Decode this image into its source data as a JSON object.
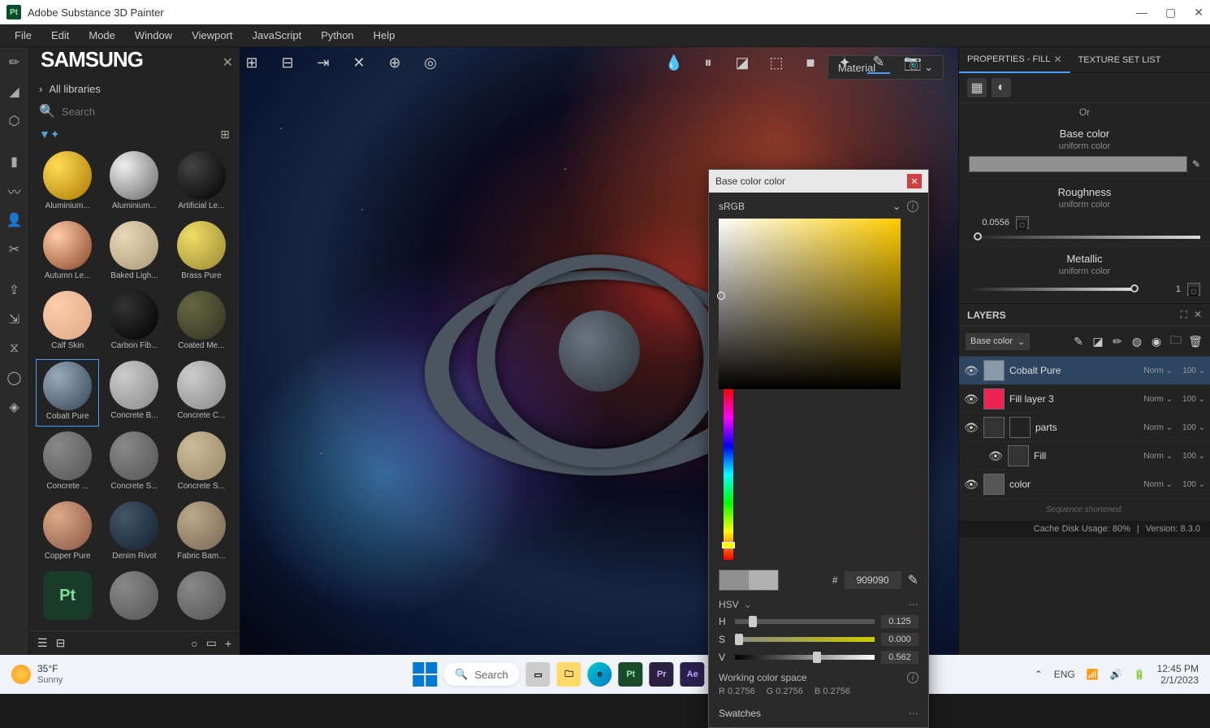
{
  "app_title": "Adobe Substance 3D Painter",
  "samsung_overlay": "SAMSUNG",
  "menus": [
    "File",
    "Edit",
    "Mode",
    "Window",
    "Viewport",
    "JavaScript",
    "Python",
    "Help"
  ],
  "asset_panel": {
    "nav": "All libraries",
    "search_placeholder": "Search",
    "items": [
      {
        "label": "Aluminium...",
        "cls": "t-gold"
      },
      {
        "label": "Aluminium...",
        "cls": "t-silver"
      },
      {
        "label": "Artificial Le...",
        "cls": "t-black"
      },
      {
        "label": "Autumn Le...",
        "cls": "t-leaf"
      },
      {
        "label": "Baked Ligh...",
        "cls": "t-tan"
      },
      {
        "label": "Brass Pure",
        "cls": "t-brass"
      },
      {
        "label": "Calf Skin",
        "cls": "t-skin"
      },
      {
        "label": "Carbon Fib...",
        "cls": "t-carbon"
      },
      {
        "label": "Coated Me...",
        "cls": "t-coat"
      },
      {
        "label": "Cobalt Pure",
        "cls": "t-cobalt",
        "selected": true
      },
      {
        "label": "Concrete B...",
        "cls": "t-conc"
      },
      {
        "label": "Concrete C...",
        "cls": "t-conc"
      },
      {
        "label": "Concrete ...",
        "cls": "t-concd"
      },
      {
        "label": "Concrete S...",
        "cls": "t-concd"
      },
      {
        "label": "Concrete S...",
        "cls": "t-tan2"
      },
      {
        "label": "Copper Pure",
        "cls": "t-copper"
      },
      {
        "label": "Denim Rivot",
        "cls": "t-denim"
      },
      {
        "label": "Fabric Bam...",
        "cls": "t-fabric"
      }
    ]
  },
  "viewport": {
    "material_dropdown": "Material"
  },
  "color_picker": {
    "title": "Base color color",
    "space": "sRGB",
    "hex_prefix": "#",
    "hex": "909090",
    "hsv_label": "HSV",
    "h": "0.125",
    "s": "0.000",
    "v": "0.562",
    "wcs": "Working color space",
    "r": "R 0.2756",
    "g": "G 0.2756",
    "b": "B 0.2756",
    "swatches": "Swatches"
  },
  "right_panel": {
    "tabs": {
      "properties": "PROPERTIES - FILL",
      "textureset": "TEXTURE SET LIST"
    },
    "or": "Or",
    "base_color": {
      "title": "Base color",
      "sub": "uniform color"
    },
    "roughness": {
      "title": "Roughness",
      "sub": "uniform color",
      "value": "0.0556"
    },
    "metallic": {
      "title": "Metallic",
      "sub": "uniform color",
      "value": "1"
    }
  },
  "layers": {
    "title": "LAYERS",
    "channel": "Base color",
    "items": [
      {
        "name": "Cobalt Pure",
        "blend": "Norm",
        "opacity": "100",
        "active": true,
        "thumb": "#8899aa"
      },
      {
        "name": "Fill layer 3",
        "blend": "Norm",
        "opacity": "100",
        "thumb": "#ee2255"
      },
      {
        "name": "parts",
        "blend": "Norm",
        "opacity": "100",
        "thumb": "#333",
        "folder": true
      },
      {
        "name": "Fill",
        "blend": "Norm",
        "opacity": "100",
        "sub": true,
        "thumb": "#333"
      },
      {
        "name": "color",
        "blend": "Norm",
        "opacity": "100",
        "thumb": "#555"
      }
    ],
    "sequence_note": "Sequence shortened."
  },
  "status": {
    "cache": "Cache Disk Usage:   80%",
    "version": "Version: 8.3.0"
  },
  "taskbar": {
    "temp": "35°F",
    "cond": "Sunny",
    "search": "Search",
    "lang": "ENG",
    "time": "12:45 PM",
    "date": "2/1/2023"
  }
}
